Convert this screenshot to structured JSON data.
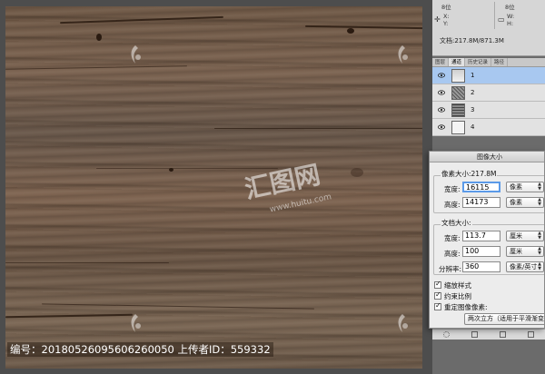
{
  "info": {
    "top_left": "8位",
    "top_right": "8位",
    "x_label": "X:",
    "y_label": "Y:",
    "w_label": "W:",
    "h_label": "H:",
    "doc_size": "文档:217.8M/871.3M"
  },
  "channels": {
    "tabs": [
      "图层",
      "通道",
      "历史记录",
      "路径"
    ],
    "active_tab": 1,
    "rows": [
      {
        "label": "1",
        "selected": true
      },
      {
        "label": "2",
        "selected": false
      },
      {
        "label": "3",
        "selected": false
      },
      {
        "label": "4",
        "selected": false
      }
    ]
  },
  "dialog": {
    "title": "图像大小",
    "pixel_dims": "像素大小:217.8M",
    "width_label": "宽度:",
    "width_value": "16115",
    "width_unit": "像素",
    "height_label": "高度:",
    "height_value": "14173",
    "height_unit": "像素",
    "doc_size_title": "文档大小:",
    "doc_width_label": "宽度:",
    "doc_width_value": "113.7",
    "doc_width_unit": "厘米",
    "doc_height_label": "高度:",
    "doc_height_value": "100",
    "doc_height_unit": "厘米",
    "resolution_label": "分辨率:",
    "resolution_value": "360",
    "resolution_unit": "像素/英寸",
    "scale_styles": "缩放样式",
    "constrain": "约束比例",
    "resample": "重定图像像素:",
    "resample_method": "两次立方（适用于平滑渐变）"
  },
  "watermark": {
    "brand": "汇图网",
    "url": "www.huitu.com"
  },
  "caption": "编号：20180526095606260050 上传者ID：559332"
}
